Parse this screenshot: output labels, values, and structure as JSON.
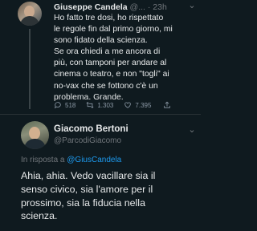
{
  "tweet": {
    "author_name": "Giuseppe Candela",
    "author_handle": "@...",
    "time": "· 23h",
    "more_icon": "ellipsis-icon",
    "text": "Ho fatto tre dosi, ho rispettato\nle regole fin dal primo giorno, mi\nsono fidato della scienza.\nSe ora chiedi a me ancora di\npiù, con tamponi per andare al\ncinema o teatro, e non \"togli\" ai\nno-vax che se fottono c'è un\nproblema. Grande.",
    "actions": {
      "reply": {
        "icon": "reply-icon",
        "count": "518"
      },
      "retweet": {
        "icon": "retweet-icon",
        "count": "1.303"
      },
      "like": {
        "icon": "heart-icon",
        "count": "7.395"
      },
      "share": {
        "icon": "share-icon"
      }
    }
  },
  "reply": {
    "author_name": "Giacomo Bertoni",
    "author_handle": "@ParcodiGiacomo",
    "more_icon": "ellipsis-icon",
    "reply_to_prefix": "In risposta a ",
    "reply_to_mention": "@GiusCandela",
    "text": "Ahia, ahia. Vedo vacillare sia il\nsenso civico, sia l'amore per il\nprossimo, sia la fiducia nella\nscienza."
  },
  "colors": {
    "background": "#0f1a1f",
    "text": "#e7e9ea",
    "muted": "#71767b",
    "accent": "#1d9bf0"
  }
}
